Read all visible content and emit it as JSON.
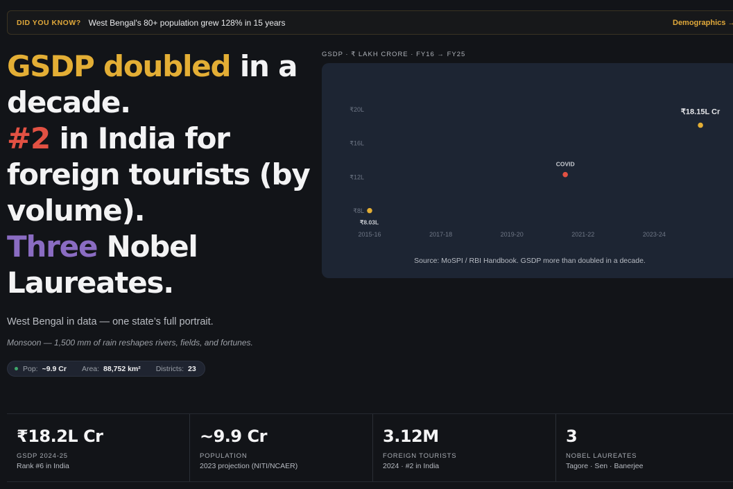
{
  "banner": {
    "tag": "DID YOU KNOW?",
    "message": "West Bengal's 80+ population grew 128% in 15 years",
    "link": "Demographics →"
  },
  "headline": {
    "l1_accent": "GSDP doubled",
    "l1_rest": " in a",
    "l2": "decade.",
    "l3_accent": "#2",
    "l3_rest": " in India for",
    "l4": "foreign tourists (by",
    "l5": "volume).",
    "l6_accent": "Three",
    "l6_rest": " Nobel",
    "l7": "Laureates."
  },
  "subtitle": "West Bengal in data — one state’s full portrait.",
  "note": "Monsoon — 1,500 mm of rain reshapes rivers, fields, and fortunes.",
  "stats": {
    "pop_label": "Pop:",
    "pop_value": "~9.9 Cr",
    "area_label": "Area:",
    "area_value": "88,752 km²",
    "districts_label": "Districts:",
    "districts_value": "23"
  },
  "chart_label": "GSDP · ₹ LAKH CRORE · FY16 → FY25",
  "chart_data": {
    "type": "scatter",
    "title": "GSDP · ₹ LAKH CRORE · FY16 → FY25",
    "y_ticks": [
      "₹8L",
      "₹12L",
      "₹16L",
      "₹20L"
    ],
    "x_ticks": [
      "2015-16",
      "2017-18",
      "2019-20",
      "2021-22",
      "2023-24"
    ],
    "ylim": [
      8,
      20
    ],
    "points": [
      {
        "x": 0,
        "y": 8.03,
        "label": "₹8.03L",
        "color": "#e3ae35"
      },
      {
        "x": 5.5,
        "y": 12.3,
        "label": "COVID",
        "color": "#e25143"
      },
      {
        "x": 9.3,
        "y": 18.15,
        "label": "₹18.15L Cr",
        "color": "#e3ae35"
      }
    ],
    "source": "Source: MoSPI / RBI Handbook. GSDP more than doubled in a decade."
  },
  "metrics": [
    {
      "value": "₹18.2L Cr",
      "label": "GSDP 2024-25",
      "sub": "Rank #6 in India"
    },
    {
      "value": "~9.9 Cr",
      "label": "POPULATION",
      "sub": "2023 projection (NITI/NCAER)"
    },
    {
      "value": "3.12M",
      "label": "FOREIGN TOURISTS",
      "sub": "2024 · #2 in India"
    },
    {
      "value": "3",
      "label": "NOBEL LAUREATES",
      "sub": "Tagore · Sen · Banerjee"
    }
  ],
  "colors": {
    "gold": "#e3ae35",
    "red": "#e25143",
    "purple": "#8a6cc2",
    "card": "#1d2533"
  }
}
